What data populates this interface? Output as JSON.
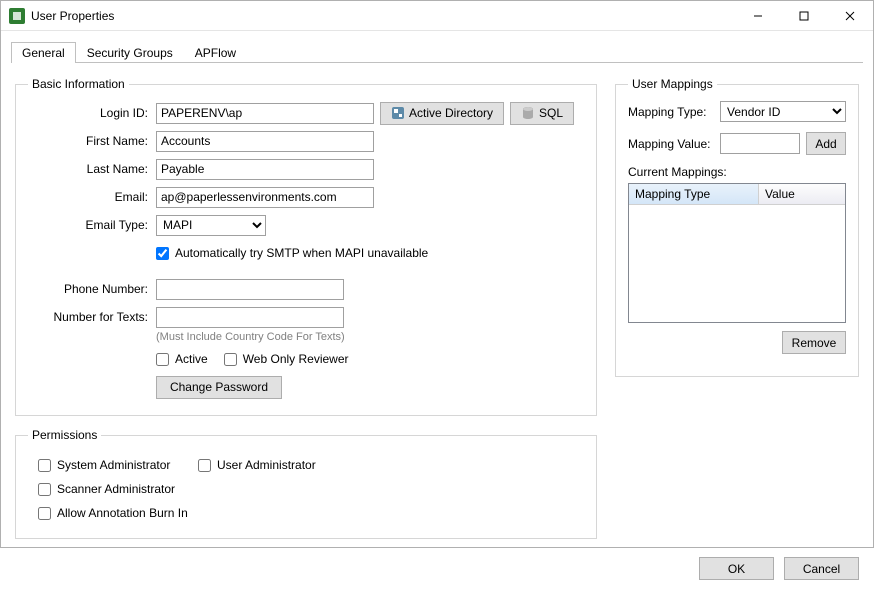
{
  "window": {
    "title": "User Properties"
  },
  "tabs": [
    {
      "label": "General",
      "active": true
    },
    {
      "label": "Security Groups",
      "active": false
    },
    {
      "label": "APFlow",
      "active": false
    }
  ],
  "basic": {
    "legend": "Basic Information",
    "labels": {
      "login_id": "Login ID:",
      "first_name": "First Name:",
      "last_name": "Last Name:",
      "email": "Email:",
      "email_type": "Email Type:",
      "phone": "Phone Number:",
      "texts": "Number for Texts:"
    },
    "values": {
      "login_id": "PAPERENV\\ap",
      "first_name": "Accounts",
      "last_name": "Payable",
      "email": "ap@paperlessenvironments.com",
      "email_type": "MAPI",
      "phone": "",
      "texts": ""
    },
    "ad_button": "Active Directory",
    "sql_button": "SQL",
    "smtp_auto": "Automatically try SMTP when MAPI unavailable",
    "smtp_auto_checked": true,
    "texts_note": "(Must Include Country Code For Texts)",
    "active": "Active",
    "web_only": "Web Only Reviewer",
    "change_password": "Change Password"
  },
  "mappings": {
    "legend": "User Mappings",
    "type_label": "Mapping Type:",
    "type_value": "Vendor ID",
    "value_label": "Mapping Value:",
    "value_value": "",
    "add": "Add",
    "current_label": "Current Mappings:",
    "columns": {
      "type": "Mapping Type",
      "value": "Value"
    },
    "remove": "Remove"
  },
  "permissions": {
    "legend": "Permissions",
    "sys_admin": "System Administrator",
    "user_admin": "User Administrator",
    "scanner_admin": "Scanner Administrator",
    "burn_in": "Allow Annotation Burn In"
  },
  "footer": {
    "ok": "OK",
    "cancel": "Cancel"
  }
}
